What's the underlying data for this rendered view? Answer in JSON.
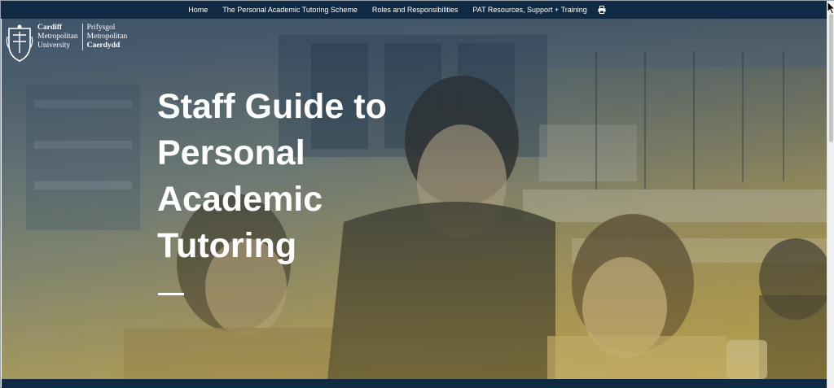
{
  "nav": {
    "items": [
      {
        "label": "Home"
      },
      {
        "label": "The Personal Academic Tutoring Scheme"
      },
      {
        "label": "Roles and Responsibilities"
      },
      {
        "label": "PAT Resources, Support + Training"
      }
    ],
    "print_icon": "print-icon"
  },
  "logo": {
    "en_line1": "Cardiff",
    "en_line2": "Metropolitan",
    "en_line3": "University",
    "cy_line1": "Prifysgol",
    "cy_line2": "Metropolitan",
    "cy_line3": "Caerdydd"
  },
  "hero": {
    "title_lines": [
      "Staff Guide to",
      "Personal",
      "Academic",
      "Tutoring"
    ]
  },
  "colors": {
    "navbar": "#102a43",
    "text": "#ffffff",
    "accent_gold": "#b8a24e"
  }
}
